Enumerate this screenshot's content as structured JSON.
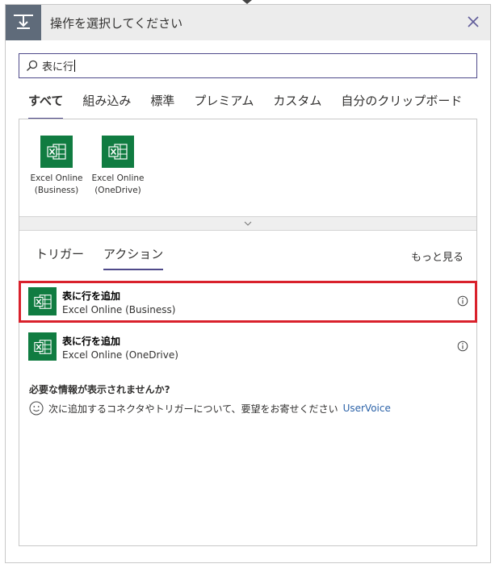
{
  "header": {
    "title": "操作を選択してください"
  },
  "search": {
    "value": "表に行"
  },
  "tabs": [
    {
      "label": "すべて",
      "active": true
    },
    {
      "label": "組み込み",
      "active": false
    },
    {
      "label": "標準",
      "active": false
    },
    {
      "label": "プレミアム",
      "active": false
    },
    {
      "label": "カスタム",
      "active": false
    },
    {
      "label": "自分のクリップボード",
      "active": false
    }
  ],
  "connectors": [
    {
      "line1": "Excel Online",
      "line2": "(Business)",
      "icon": "excel-icon"
    },
    {
      "line1": "Excel Online",
      "line2": "(OneDrive)",
      "icon": "excel-icon"
    }
  ],
  "subtabs": [
    {
      "label": "トリガー",
      "active": false
    },
    {
      "label": "アクション",
      "active": true
    }
  ],
  "see_more": "もっと見る",
  "actions": [
    {
      "title": "表に行を追加",
      "connector": "Excel Online (Business)",
      "highlighted": true
    },
    {
      "title": "表に行を追加",
      "connector": "Excel Online (OneDrive)",
      "highlighted": false
    }
  ],
  "help": {
    "title": "必要な情報が表示されませんか?",
    "text": "次に追加するコネクタやトリガーについて、要望をお寄せください",
    "link": "UserVoice"
  },
  "colors": {
    "accent": "#4f4a8a",
    "excel_green": "#107c41",
    "highlight_border": "#d9212c",
    "link": "#2b62a8",
    "header_icon_bg": "#5f6b7a"
  }
}
